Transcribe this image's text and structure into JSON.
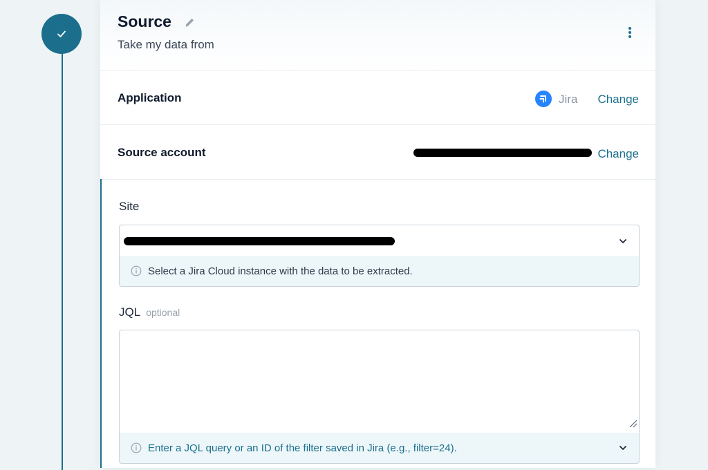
{
  "source": {
    "title": "Source",
    "subtitle": "Take my data from"
  },
  "application": {
    "label": "Application",
    "app_name": "Jira",
    "app_icon": "jira-icon",
    "change_label": "Change"
  },
  "source_account": {
    "label": "Source account",
    "change_label": "Change"
  },
  "site": {
    "label": "Site",
    "hint": "Select a Jira Cloud instance with the data to be extracted."
  },
  "jql": {
    "label": "JQL",
    "optional": "optional",
    "value": "",
    "hint": "Enter a JQL query or an ID of the filter saved in Jira (e.g., filter=24)."
  },
  "colors": {
    "accent": "#1b6f8c",
    "jira_blue": "#2684ff",
    "hint_bg": "#edf6f9"
  }
}
